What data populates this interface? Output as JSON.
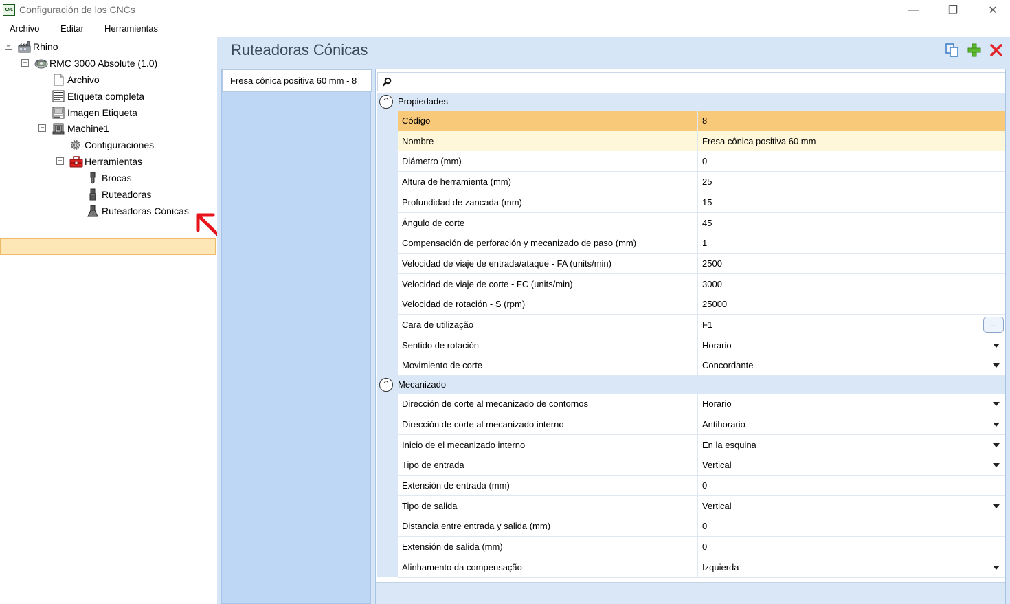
{
  "window": {
    "title": "Configuración de los CNCs",
    "icon_text": "CNC",
    "minimize_glyph": "—",
    "restore_glyph": "❐",
    "close_glyph": "✕"
  },
  "menu": {
    "items": [
      "Archivo",
      "Editar",
      "Herramientas"
    ]
  },
  "tree": {
    "nodes": [
      {
        "label": "Rhino",
        "icon": "factory-icon",
        "expanded": true
      },
      {
        "label": "RMC 3000 Absolute (1.0)",
        "icon": "machine-icon",
        "expanded": true
      },
      {
        "label": "Archivo",
        "icon": "file-icon"
      },
      {
        "label": "Etiqueta completa",
        "icon": "label-icon"
      },
      {
        "label": "Imagen Etiqueta",
        "icon": "image-label-icon"
      },
      {
        "label": "Machine1",
        "icon": "machine-node-icon",
        "expanded": true
      },
      {
        "label": "Configuraciones",
        "icon": "gear-icon"
      },
      {
        "label": "Herramientas",
        "icon": "toolbox-icon",
        "expanded": true
      },
      {
        "label": "Brocas",
        "icon": "drill-bit-icon"
      },
      {
        "label": "Ruteadoras",
        "icon": "router-bit-icon"
      },
      {
        "label": "Ruteadoras Cónicas",
        "icon": "conical-router-bit-icon",
        "selected": true
      }
    ]
  },
  "panel": {
    "title": "Ruteadoras Cónicas",
    "toolbar": {
      "copy_icon": "copy-icon",
      "add_icon": "add-icon",
      "delete_icon": "delete-icon"
    },
    "tool_list": [
      "Fresa cônica positiva 60 mm - 8"
    ]
  },
  "properties": {
    "search_icon": "search-icon",
    "categories": [
      {
        "label": "Propiedades",
        "toggle": "^",
        "rows": [
          {
            "name": "Código",
            "value": "8",
            "state": "selected"
          },
          {
            "name": "Nombre",
            "value": "Fresa cônica positiva 60 mm",
            "state": "hover"
          },
          {
            "name": "Diámetro (mm)",
            "value": "0"
          },
          {
            "name": "Altura de herramienta (mm)",
            "value": "25"
          },
          {
            "name": "Profundidad de zancada (mm)",
            "value": "15"
          },
          {
            "name": "Ángulo de corte",
            "value": "45"
          },
          {
            "name": "Compensación de perforación y mecanizado de paso (mm)",
            "value": "1"
          },
          {
            "name": "Velocidad de viaje de entrada/ataque - FA (units/min)",
            "value": "2500"
          },
          {
            "name": "Velocidad de viaje de corte - FC (units/min)",
            "value": "3000"
          },
          {
            "name": "Velocidad de rotación - S (rpm)",
            "value": "25000"
          },
          {
            "name": "Cara de utilização",
            "value": "F1",
            "editor": "ellipsis",
            "button_label": "..."
          },
          {
            "name": "Sentido de rotación",
            "value": "Horario",
            "editor": "dropdown"
          },
          {
            "name": "Movimiento de corte",
            "value": "Concordante",
            "editor": "dropdown"
          }
        ]
      },
      {
        "label": "Mecanizado",
        "toggle": "^",
        "rows": [
          {
            "name": "Dirección de corte al mecanizado de contornos",
            "value": "Horario",
            "editor": "dropdown"
          },
          {
            "name": "Dirección de corte al mecanizado interno",
            "value": "Antihorario",
            "editor": "dropdown"
          },
          {
            "name": "Inicio de el mecanizado interno",
            "value": "En la esquina",
            "editor": "dropdown"
          },
          {
            "name": "Tipo de entrada",
            "value": "Vertical",
            "editor": "dropdown"
          },
          {
            "name": "Extensión de entrada (mm)",
            "value": "0"
          },
          {
            "name": "Tipo de salida",
            "value": "Vertical",
            "editor": "dropdown"
          },
          {
            "name": "Distancia entre entrada y salida (mm)",
            "value": "0"
          },
          {
            "name": "Extensión de salida (mm)",
            "value": "0"
          },
          {
            "name": "Alinhamento da compensação",
            "value": "Izquierda",
            "editor": "dropdown"
          }
        ]
      }
    ]
  },
  "colors": {
    "selection": "#f9c97a",
    "hover": "#fff7d9",
    "panel_bg": "#d6e6f7",
    "annotation_arrow": "#e8141b"
  }
}
